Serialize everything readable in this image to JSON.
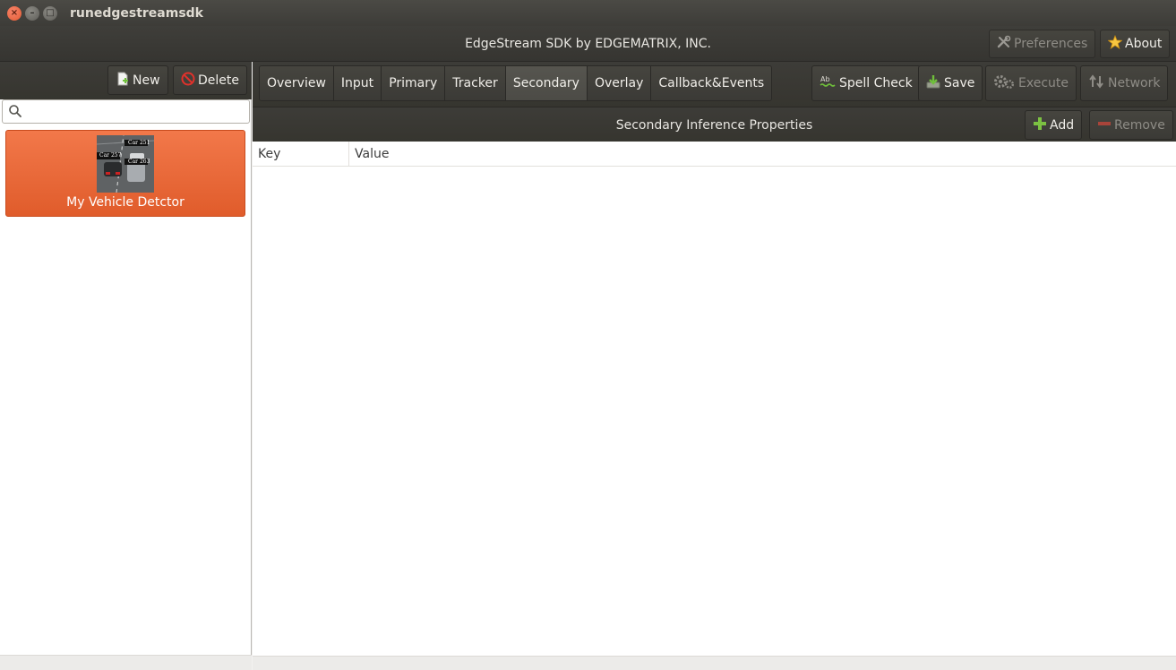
{
  "window": {
    "title": "runedgestreamsdk",
    "close_glyph": "×",
    "min_glyph": "–",
    "max_glyph": "□"
  },
  "header": {
    "title": "EdgeStream SDK by EDGEMATRIX, INC.",
    "preferences_label": "Preferences",
    "about_label": "About",
    "preferences_icon": "tools-icon",
    "about_icon": "star-icon"
  },
  "sidebar": {
    "new_label": "New",
    "delete_label": "Delete",
    "search": {
      "value": "",
      "placeholder": ""
    },
    "items": [
      {
        "label": "My Vehicle Detctor",
        "thumb_tags": [
          "Car 251",
          "Car 257",
          "Car 263"
        ]
      }
    ]
  },
  "tabs": [
    {
      "label": "Overview",
      "active": false
    },
    {
      "label": "Input",
      "active": false
    },
    {
      "label": "Primary",
      "active": false
    },
    {
      "label": "Tracker",
      "active": false
    },
    {
      "label": "Secondary",
      "active": true
    },
    {
      "label": "Overlay",
      "active": false
    },
    {
      "label": "Callback&Events",
      "active": false
    }
  ],
  "toolbar": {
    "spell_check_label": "Spell Check",
    "save_label": "Save",
    "execute_label": "Execute",
    "network_label": "Network"
  },
  "properties": {
    "title": "Secondary Inference Properties",
    "add_label": "Add",
    "remove_label": "Remove",
    "columns": [
      "Key",
      "Value"
    ],
    "rows": []
  },
  "colors": {
    "accent": "#e9663a",
    "toolbar_dark": "#3b3a36",
    "add_icon": "#7cc142",
    "remove_icon": "#c0392b"
  }
}
